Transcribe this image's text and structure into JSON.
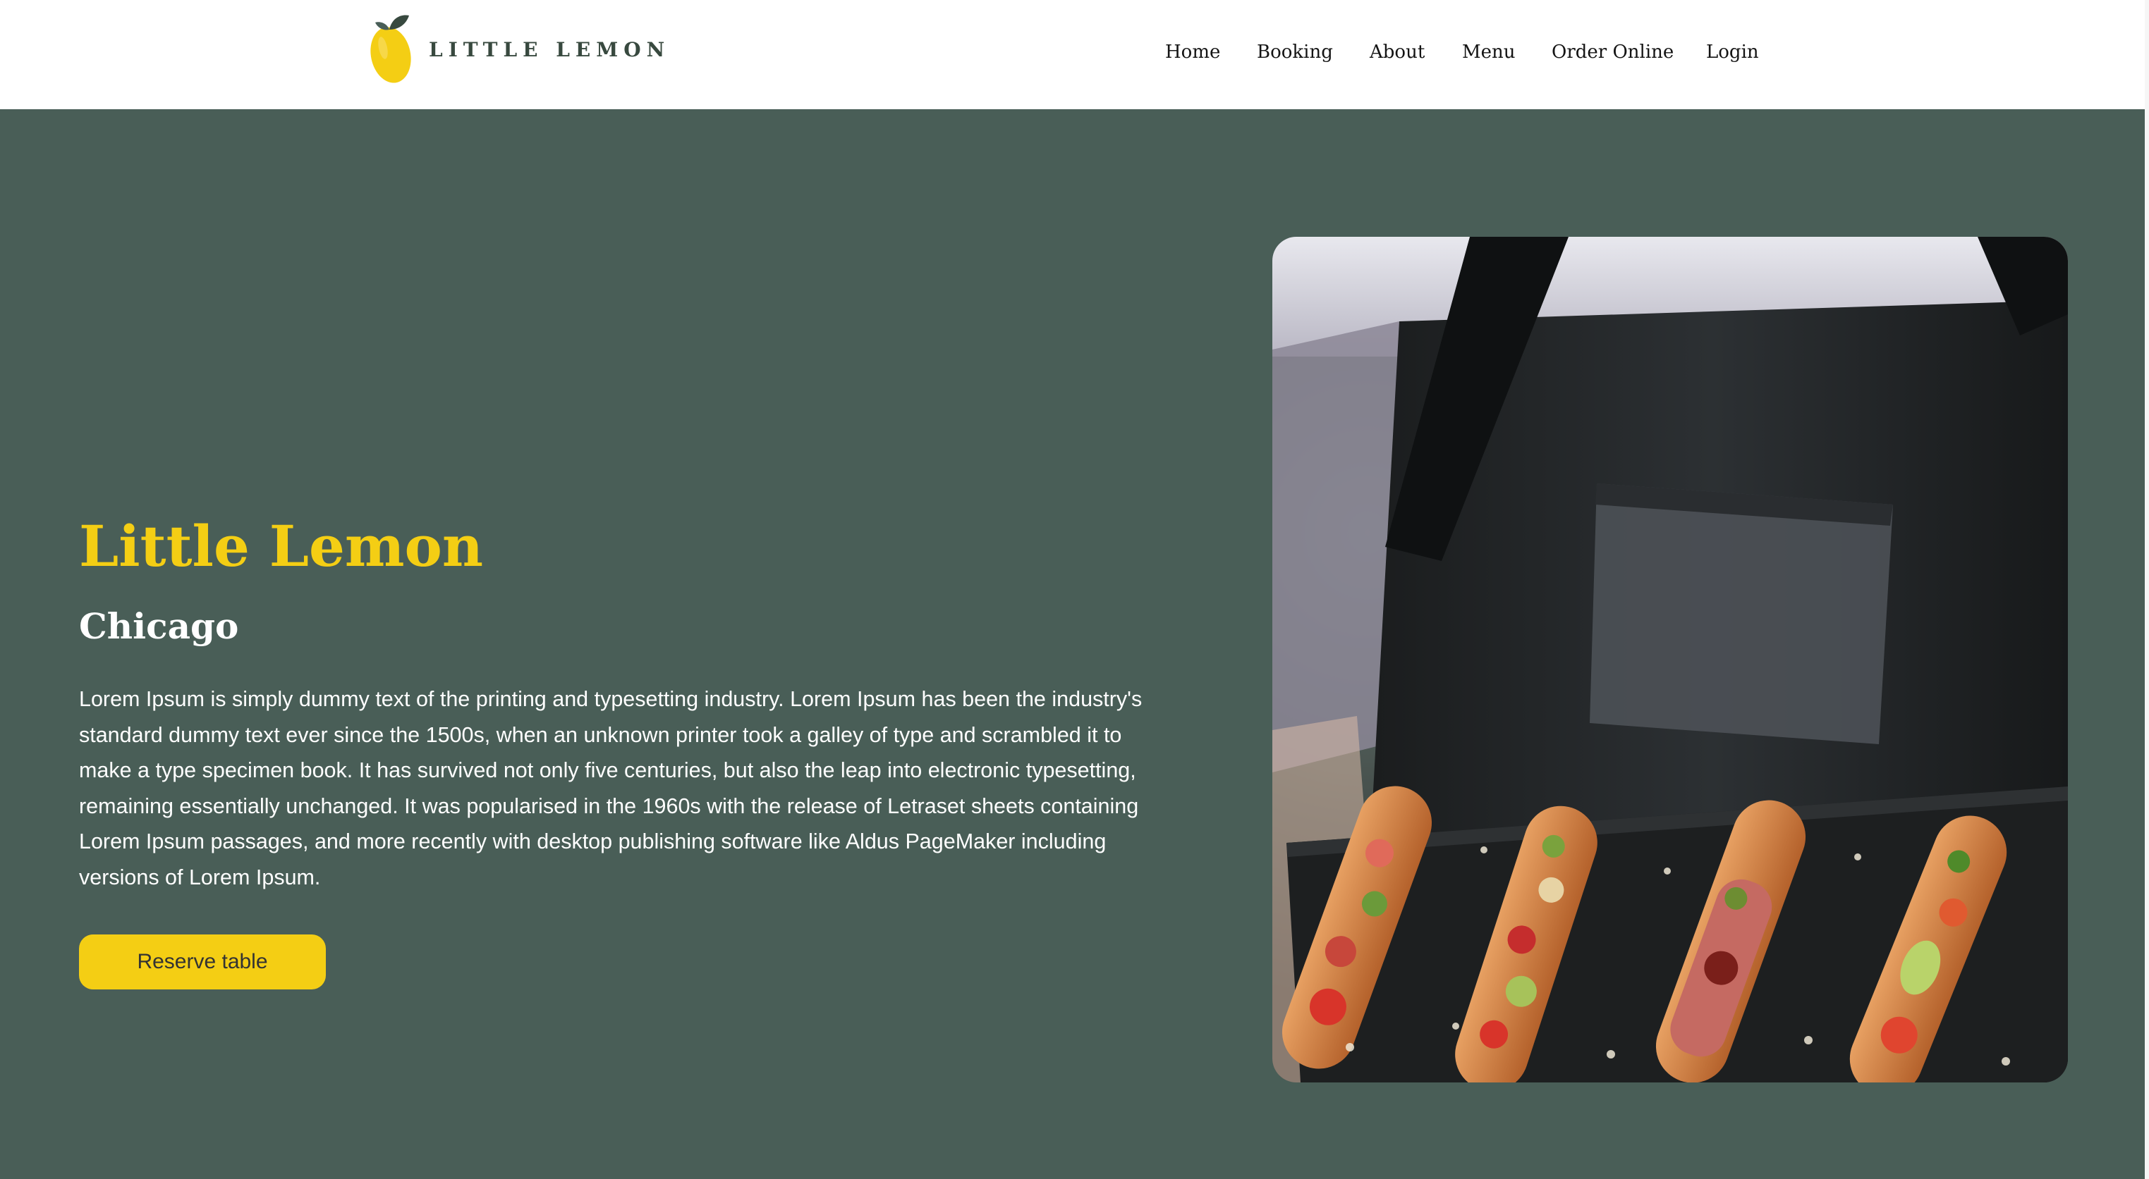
{
  "header": {
    "logo_text": "LITTLE LEMON",
    "nav": [
      "Home",
      "Booking",
      "About",
      "Menu",
      "Order Online",
      "Login"
    ]
  },
  "hero": {
    "title": "Little Lemon",
    "subtitle": "Chicago",
    "description": "Lorem Ipsum is simply dummy text of the printing and typesetting industry. Lorem Ipsum has been the industry's standard dummy text ever since the 1500s, when an unknown printer took a galley of type and scrambled it to make a type specimen book. It has survived not only five centuries, but also the leap into electronic typesetting, remaining essentially unchanged. It was popularised in the 1960s with the release of Letraset sheets containing Lorem Ipsum passages, and more recently with desktop publishing software like Aldus PageMaker including versions of Lorem Ipsum.",
    "cta_label": "Reserve table",
    "image_icon": "food-photo"
  },
  "colors": {
    "primary_green": "#495e57",
    "primary_yellow": "#f4ce14",
    "logo_text": "#38493f"
  }
}
